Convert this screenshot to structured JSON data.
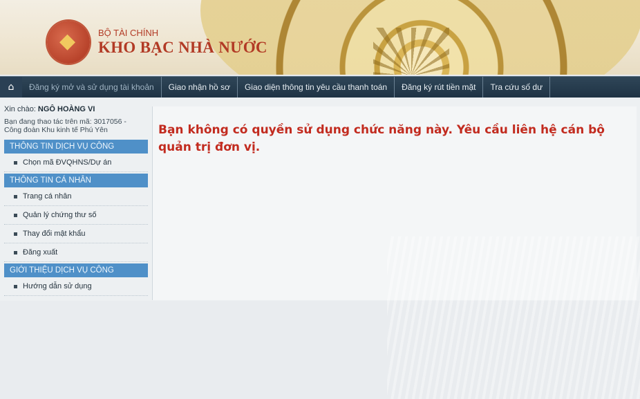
{
  "header": {
    "ministry": "BỘ TÀI CHÍNH",
    "org": "KHO BẠC NHÀ NƯỚC"
  },
  "nav": {
    "home_icon": "home-icon",
    "items": [
      "Đăng ký mở và sử dụng tài khoản",
      "Giao nhận hồ sơ",
      "Giao diện thông tin yêu cầu thanh toán",
      "Đăng ký rút tiền mặt",
      "Tra cứu số dư"
    ]
  },
  "sidebar": {
    "greeting_prefix": "Xin chào: ",
    "user": "NGÔ HOÀNG VI",
    "unit_line1": "Bạn đang thao tác trên mã: 3017056 -",
    "unit_line2": "Công đoàn Khu kinh tế Phú Yên",
    "sections": [
      {
        "title": "THÔNG TIN DỊCH VỤ CÔNG",
        "items": [
          "Chọn mã ĐVQHNS/Dự án"
        ]
      },
      {
        "title": "THÔNG TIN CÁ NHÂN",
        "items": [
          "Trang cá nhân",
          "Quản lý chứng thư số",
          "Thay đổi mật khẩu",
          "Đăng xuất"
        ]
      },
      {
        "title": "GIỚI THIỆU DỊCH VỤ CÔNG",
        "items": [
          "Hướng dẫn sử dụng"
        ]
      }
    ]
  },
  "main": {
    "message": "Bạn không có quyền sử dụng chức năng này. Yêu cầu liên hệ cán bộ quản trị đơn vị."
  },
  "colors": {
    "brand_red": "#b23a25",
    "nav_bg": "#1f3344",
    "section_blue": "#4f90c8",
    "error_red": "#c22b1f"
  }
}
